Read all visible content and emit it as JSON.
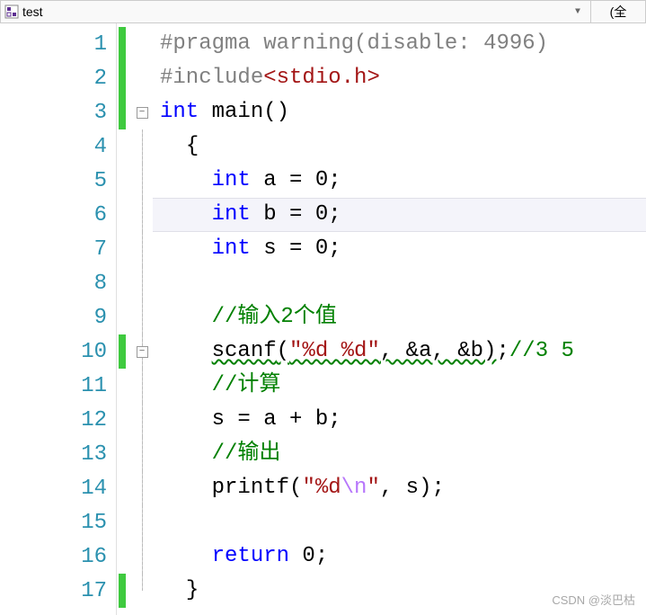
{
  "header": {
    "filename": "test",
    "right_label": "(全"
  },
  "gutter": {
    "lines": [
      "1",
      "2",
      "3",
      "4",
      "5",
      "6",
      "7",
      "8",
      "9",
      "10",
      "11",
      "12",
      "13",
      "14",
      "15",
      "16",
      "17"
    ]
  },
  "markers": {
    "green_lines": [
      1,
      2,
      3,
      10,
      17
    ]
  },
  "fold": {
    "box_at_line3": "−",
    "box_at_line10": "−"
  },
  "code": {
    "l1": {
      "pre": "#pragma",
      "rest": " warning(disable: 4996)"
    },
    "l2": {
      "pre": "#include",
      "inc": "<stdio.h>"
    },
    "l3": {
      "kw": "int",
      "rest": " main()"
    },
    "l4": {
      "brace": "{"
    },
    "l5": {
      "kw": "int",
      "var": " a = 0;"
    },
    "l6": {
      "kw": "int",
      "var": " b = 0;"
    },
    "l7": {
      "kw": "int",
      "var": " s = 0;"
    },
    "l9": {
      "cmt": "//输入2个值"
    },
    "l10": {
      "fn": "scanf",
      "p1": "(",
      "str": "\"%d %d\"",
      "args": ", &a, &b)",
      "semi": ";",
      "cmt": "//3 5"
    },
    "l11": {
      "cmt": "//计算"
    },
    "l12": {
      "stmt": "s = a + b;"
    },
    "l13": {
      "cmt": "//输出"
    },
    "l14": {
      "fn": "printf",
      "p1": "(",
      "str1": "\"%d",
      "esc": "\\n",
      "str2": "\"",
      "args": ", s);"
    },
    "l16": {
      "kw": "return",
      "rest": " 0;"
    },
    "l17": {
      "brace": "}"
    }
  },
  "watermark": "CSDN @淡巴枯"
}
